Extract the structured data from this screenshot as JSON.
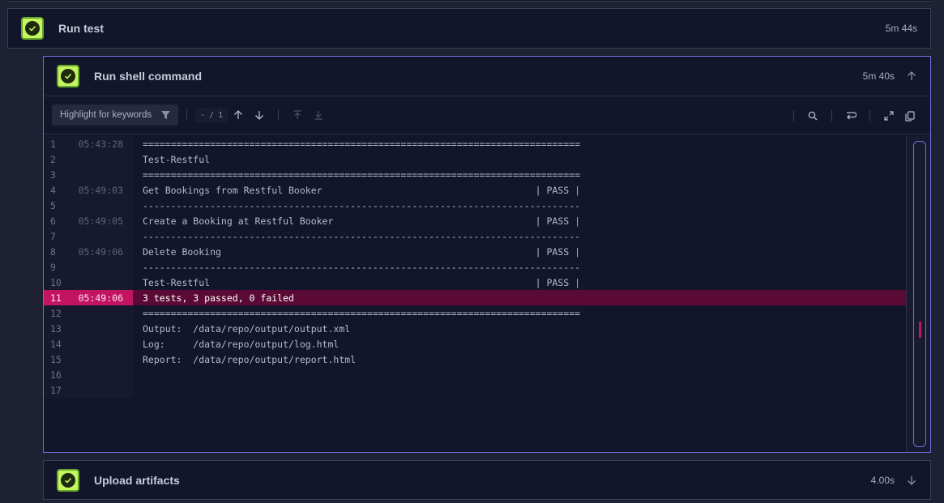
{
  "steps": {
    "run_test": {
      "title": "Run test",
      "duration": "5m 44s",
      "status": "success"
    },
    "run_shell": {
      "title": "Run shell command",
      "duration": "5m 40s",
      "status": "success"
    },
    "upload": {
      "title": "Upload artifacts",
      "duration": "4.00s",
      "status": "success"
    }
  },
  "toolbar": {
    "filter_label": "Highlight for keywords",
    "pager_current": "-",
    "pager_sep": "/",
    "pager_total": "1"
  },
  "log": {
    "highlight_line": 11,
    "lines": [
      {
        "n": "1",
        "ts": "05:43:28",
        "text": "=============================================================================="
      },
      {
        "n": "2",
        "ts": "",
        "text": "Test-Restful"
      },
      {
        "n": "3",
        "ts": "",
        "text": "=============================================================================="
      },
      {
        "n": "4",
        "ts": "05:49:03",
        "text": "Get Bookings from Restful Booker                                      | PASS |"
      },
      {
        "n": "5",
        "ts": "",
        "text": "------------------------------------------------------------------------------"
      },
      {
        "n": "6",
        "ts": "05:49:05",
        "text": "Create a Booking at Restful Booker                                    | PASS |"
      },
      {
        "n": "7",
        "ts": "",
        "text": "------------------------------------------------------------------------------"
      },
      {
        "n": "8",
        "ts": "05:49:06",
        "text": "Delete Booking                                                        | PASS |"
      },
      {
        "n": "9",
        "ts": "",
        "text": "------------------------------------------------------------------------------"
      },
      {
        "n": "10",
        "ts": "",
        "text": "Test-Restful                                                          | PASS |"
      },
      {
        "n": "11",
        "ts": "05:49:06",
        "text": "3 tests, 3 passed, 0 failed"
      },
      {
        "n": "12",
        "ts": "",
        "text": "=============================================================================="
      },
      {
        "n": "13",
        "ts": "",
        "text": "Output:  /data/repo/output/output.xml"
      },
      {
        "n": "14",
        "ts": "",
        "text": "Log:     /data/repo/output/log.html"
      },
      {
        "n": "15",
        "ts": "",
        "text": "Report:  /data/repo/output/report.html"
      },
      {
        "n": "16",
        "ts": "",
        "text": ""
      },
      {
        "n": "17",
        "ts": "",
        "text": ""
      }
    ]
  },
  "colors": {
    "success_green": "#c6f560",
    "active_border": "#7a6ae0",
    "highlight_row": "#c31464"
  }
}
